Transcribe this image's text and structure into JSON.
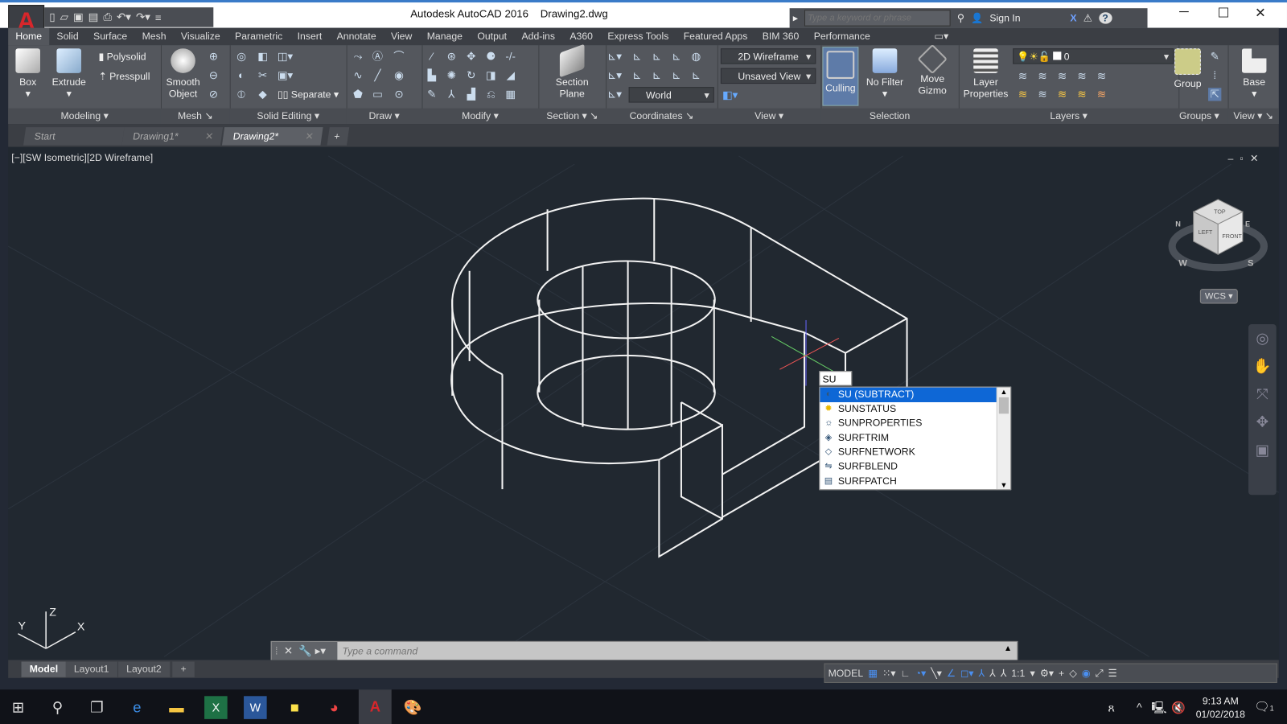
{
  "app": {
    "title": "Autodesk AutoCAD 2016",
    "file": "Drawing2.dwg",
    "logo": "A"
  },
  "search": {
    "placeholder": "Type a keyword or phrase",
    "sign_in": "Sign In"
  },
  "ribbon_tabs": [
    "Home",
    "Solid",
    "Surface",
    "Mesh",
    "Visualize",
    "Parametric",
    "Insert",
    "Annotate",
    "View",
    "Manage",
    "Output",
    "Add-ins",
    "A360",
    "Express Tools",
    "Featured Apps",
    "BIM 360",
    "Performance"
  ],
  "panels": {
    "modeling": {
      "label": "Modeling",
      "box": "Box",
      "extrude": "Extrude",
      "polysolid": "Polysolid",
      "presspull": "Presspull"
    },
    "mesh": {
      "label": "Mesh",
      "smooth": "Smooth",
      "object": "Object"
    },
    "solid_editing": {
      "label": "Solid Editing",
      "separate": "Separate"
    },
    "draw": {
      "label": "Draw"
    },
    "modify": {
      "label": "Modify"
    },
    "section": {
      "label": "Section",
      "plane1": "Section",
      "plane2": "Plane"
    },
    "coordinates": {
      "label": "Coordinates",
      "world": "World"
    },
    "view": {
      "label": "View",
      "visual_style": "2D Wireframe",
      "named_view": "Unsaved View"
    },
    "selection": {
      "label": "Selection",
      "culling": "Culling",
      "no_filter": "No Filter",
      "move1": "Move",
      "move2": "Gizmo"
    },
    "layers": {
      "label": "Layers",
      "props1": "Layer",
      "props2": "Properties",
      "current_layer": "0"
    },
    "groups": {
      "label": "Groups",
      "group": "Group"
    },
    "view2": {
      "label": "View",
      "base": "Base"
    }
  },
  "doc_tabs": [
    {
      "label": "Start"
    },
    {
      "label": "Drawing1*"
    },
    {
      "label": "Drawing2*",
      "active": true
    }
  ],
  "viewport": {
    "label": "[−][SW Isometric][2D Wireframe]",
    "wcs": "WCS",
    "ucs": {
      "x": "X",
      "y": "Y",
      "z": "Z"
    },
    "viewcube": {
      "top": "TOP",
      "left": "LEFT",
      "front": "FRONT",
      "compass": [
        "W",
        "S",
        "N",
        "E"
      ]
    }
  },
  "autocomplete": {
    "typed": "SU",
    "items": [
      {
        "label": "SU (SUBTRACT)",
        "icon": "subtract-icon",
        "selected": true
      },
      {
        "label": "SUNSTATUS",
        "icon": "sun-icon"
      },
      {
        "label": "SUNPROPERTIES",
        "icon": "sun-properties-icon"
      },
      {
        "label": "SURFTRIM",
        "icon": "surftrim-icon"
      },
      {
        "label": "SURFNETWORK",
        "icon": "surfnetwork-icon"
      },
      {
        "label": "SURFBLEND",
        "icon": "surfblend-icon"
      },
      {
        "label": "SURFPATCH",
        "icon": "surfpatch-icon"
      }
    ]
  },
  "command": {
    "placeholder": "Type a command"
  },
  "layout_tabs": [
    "Model",
    "Layout1",
    "Layout2"
  ],
  "status": {
    "model": "MODEL",
    "scale": "1:1"
  },
  "taskbar": {
    "time": "9:13 AM",
    "date": "01/02/2018",
    "notifications": "1"
  },
  "colors": {
    "accent": "#0e67d6",
    "viewport_bg": "#212830",
    "wire": "#ffffff",
    "brand": "#d8262b"
  }
}
